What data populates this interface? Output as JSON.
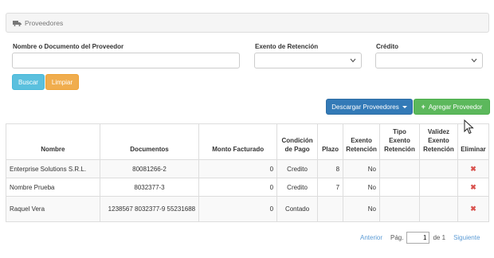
{
  "header": {
    "title": "Proveedores",
    "icon": "truck-icon"
  },
  "filters": {
    "name_label": "Nombre o Documento del Proveedor",
    "name_value": "",
    "exento_label": "Exento de Retención",
    "exento_value": "",
    "credito_label": "Crédito",
    "credito_value": ""
  },
  "buttons": {
    "buscar": "Buscar",
    "limpiar": "Limpiar",
    "descargar": "Descargar Proveedores",
    "agregar": "Agregar Proveedor"
  },
  "table": {
    "columns": [
      "Nombre",
      "Documentos",
      "Monto Facturado",
      "Condición de Pago",
      "Plazo",
      "Exento Retención",
      "Tipo Exento Retención",
      "Validez Exento Retención",
      "Eliminar"
    ],
    "rows": [
      {
        "nombre": "Enterprise Solutions S.R.L.",
        "documentos": "80081266-2",
        "monto": "0",
        "condicion": "Credito",
        "plazo": "8",
        "exento": "No",
        "tipo": "",
        "validez": ""
      },
      {
        "nombre": "Nombre Prueba",
        "documentos": "8032377-3",
        "monto": "0",
        "condicion": "Credito",
        "plazo": "7",
        "exento": "No",
        "tipo": "",
        "validez": ""
      },
      {
        "nombre": "Raquel Vera",
        "documentos": "1238567   8032377-9 55231688",
        "monto": "0",
        "condicion": "Contado",
        "plazo": "",
        "exento": "No",
        "tipo": "",
        "validez": ""
      }
    ]
  },
  "pagination": {
    "prev": "Anterior",
    "page_label": "Pág.",
    "page_value": "1",
    "of_label": "de 1",
    "next": "Siguiente"
  },
  "colors": {
    "info": "#5bc0de",
    "warning": "#f0ad4e",
    "primary": "#337ab7",
    "success": "#5cb85c",
    "danger": "#d9534f"
  }
}
